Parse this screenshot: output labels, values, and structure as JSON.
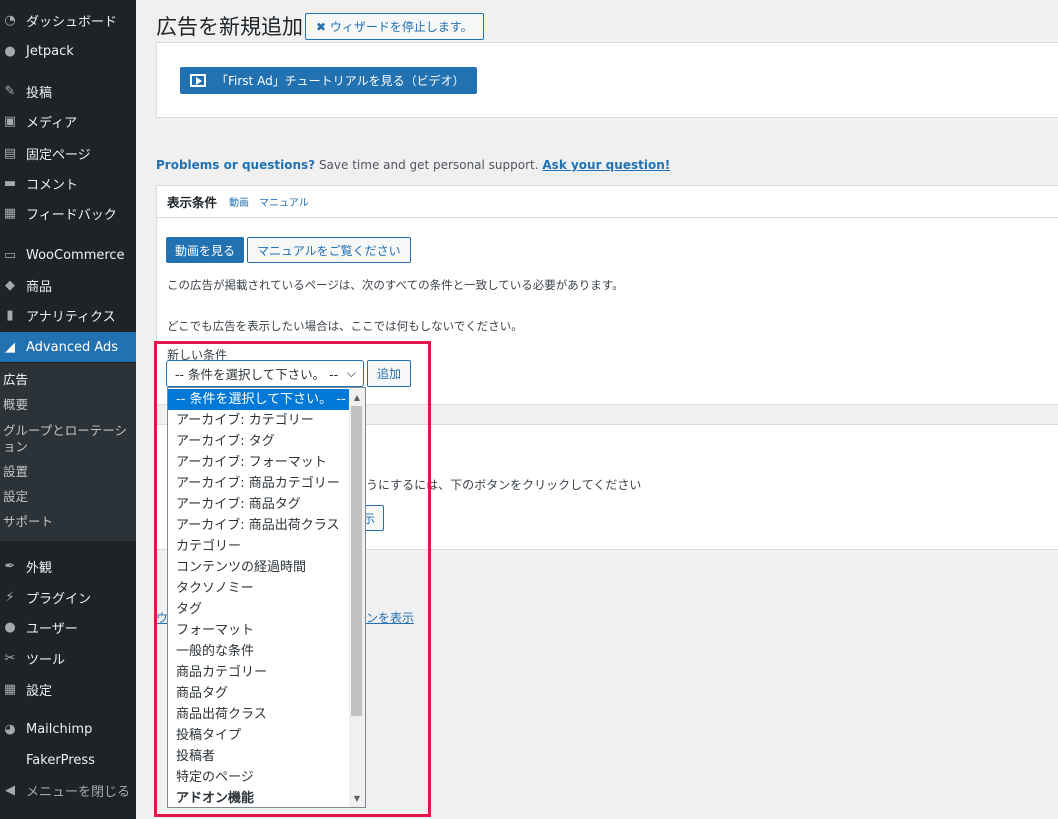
{
  "sidebar": {
    "items": [
      {
        "label": "ダッシュボード",
        "icon": "dashboard-icon",
        "glyph": "◔"
      },
      {
        "label": "Jetpack",
        "icon": "jetpack-icon",
        "glyph": "●"
      },
      {
        "label": "投稿",
        "icon": "pin-icon",
        "glyph": "✎"
      },
      {
        "label": "メディア",
        "icon": "media-icon",
        "glyph": "▣"
      },
      {
        "label": "固定ページ",
        "icon": "page-icon",
        "glyph": "▤"
      },
      {
        "label": "コメント",
        "icon": "comment-icon",
        "glyph": "▬"
      },
      {
        "label": "フィードバック",
        "icon": "feedback-icon",
        "glyph": "▦"
      },
      {
        "label": "WooCommerce",
        "icon": "woocommerce-icon",
        "glyph": "▭"
      },
      {
        "label": "商品",
        "icon": "product-icon",
        "glyph": "◆"
      },
      {
        "label": "アナリティクス",
        "icon": "analytics-icon",
        "glyph": "▮"
      },
      {
        "label": "Advanced Ads",
        "icon": "advanced-ads-icon",
        "glyph": "◢"
      }
    ],
    "submenu": [
      "広告",
      "概要",
      "グループとローテーション",
      "設置",
      "設定",
      "サポート"
    ],
    "items_after": [
      {
        "label": "外観",
        "icon": "appearance-icon",
        "glyph": "✒"
      },
      {
        "label": "プラグイン",
        "icon": "plugin-icon",
        "glyph": "⚡"
      },
      {
        "label": "ユーザー",
        "icon": "user-icon",
        "glyph": "●"
      },
      {
        "label": "ツール",
        "icon": "tools-icon",
        "glyph": "✂"
      },
      {
        "label": "設定",
        "icon": "settings-icon",
        "glyph": "▦"
      },
      {
        "label": "Mailchimp",
        "icon": "mailchimp-icon",
        "glyph": "◕"
      },
      {
        "label": "FakerPress",
        "icon": "fakerpress-icon",
        "glyph": ""
      },
      {
        "label": "メニューを閉じる",
        "icon": "collapse-icon",
        "glyph": "◀"
      }
    ]
  },
  "header": {
    "title": "広告を新規追加",
    "stop_wizard": "✖ ウィザードを停止します。"
  },
  "tutorial": {
    "label": "「First Ad」チュートリアルを見る（ビデオ）"
  },
  "support": {
    "prefix": "Problems or questions?",
    "middle": " Save time and get personal support. ",
    "link": "Ask your question!"
  },
  "conditions": {
    "title": "表示条件",
    "video_link": "動画",
    "manual_link": "マニュアル",
    "watch_video": "動画を見る",
    "view_manual": "マニュアルをご覧ください",
    "desc1": "この広告が掲載されているページは、次のすべての条件と一致している必要があります。",
    "desc2": "どこでも広告を表示したい場合は、ここでは何もしないでください。",
    "new_condition_label": "新しい条件",
    "select_value": "-- 条件を選択して下さい。 --",
    "add": "追加"
  },
  "dropdown": {
    "options": [
      "-- 条件を選択して下さい。 --",
      "アーカイブ: カテゴリー",
      "アーカイブ: タグ",
      "アーカイブ: フォーマット",
      "アーカイブ: 商品カテゴリー",
      "アーカイブ: 商品タグ",
      "アーカイブ: 商品出荷クラス",
      "カテゴリー",
      "コンテンツの経過時間",
      "タクソノミー",
      "タグ",
      "フォーマット",
      "一般的な条件",
      "商品カテゴリー",
      "商品タグ",
      "商品出荷クラス",
      "投稿タイプ",
      "投稿者",
      "特定のページ",
      "アドオン機能"
    ]
  },
  "partial": {
    "text1": "うにするには、下のボタンをクリックしてください",
    "text2": "示",
    "text3": "ンを表示",
    "text4": "ウ"
  }
}
